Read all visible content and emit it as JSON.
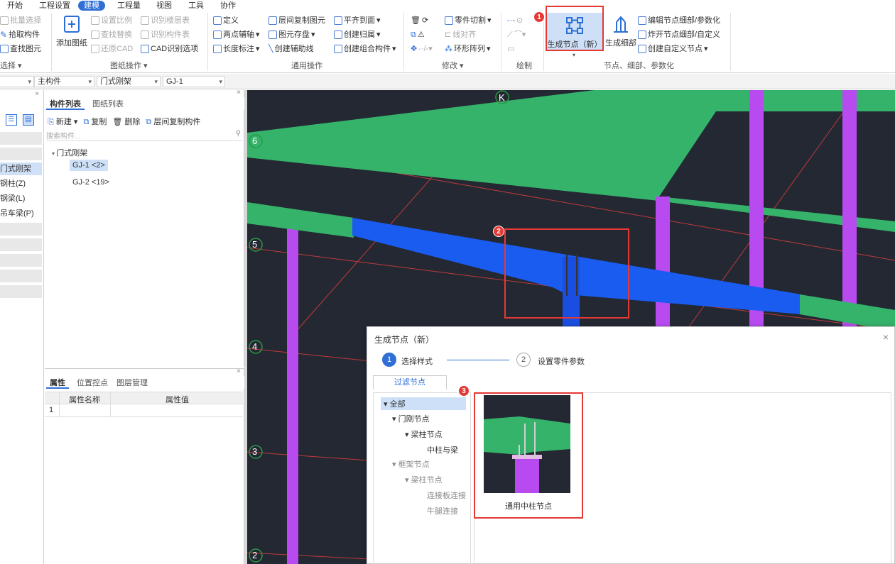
{
  "menu": [
    "开始",
    "工程设置",
    "建模",
    "工程量",
    "视图",
    "工具",
    "协作"
  ],
  "ribbon": {
    "select_group": {
      "items": [
        "批量选择",
        "拾取构件",
        "查找图元"
      ],
      "label": "选择"
    },
    "drawing_ops": {
      "add_drawing": "添加图纸",
      "items": [
        "设置比例",
        "查找替换",
        "还原CAD",
        "识别楼层表",
        "识别构件表",
        "CAD识别选项"
      ],
      "label": "图纸操作"
    },
    "general_ops": {
      "col1": [
        "定义",
        "两点辅轴",
        "长度标注"
      ],
      "col2": [
        "层间复制图元",
        "图元存盘",
        "创建辅助线"
      ],
      "col3": [
        "平齐到面",
        "创建归属",
        "创建组合构件"
      ],
      "label": "通用操作"
    },
    "modify": {
      "items": [
        "零件切割",
        "线对齐",
        "环形阵列"
      ],
      "label": "修改"
    },
    "draw": {
      "label": "绘制"
    },
    "nodes": {
      "gen_node": "生成节点（新）",
      "gen_detail": "生成细部",
      "items": [
        "编辑节点细部/参数化",
        "炸开节点细部/自定义",
        "创建自定义节点"
      ],
      "label": "节点、细部、参数化"
    }
  },
  "selbar": {
    "s2": "主构件",
    "s3": "门式刚架",
    "s4": "GJ-1"
  },
  "left_narrow": {
    "rows": [
      "门式刚架",
      "钢柱(Z)",
      "钢梁(L)",
      "吊车梁(P)"
    ]
  },
  "comp_panel": {
    "tabs": [
      "构件列表",
      "图纸列表"
    ],
    "toolbar": [
      "新建",
      "复制",
      "删除",
      "层间复制构件"
    ],
    "search_placeholder": "搜索构件...",
    "tree_root": "门式刚架",
    "items": [
      "GJ-1 <2>",
      "GJ-2 <19>"
    ]
  },
  "props_panel": {
    "tabs": [
      "属性",
      "位置控点",
      "图层管理"
    ],
    "col_name": "属性名称",
    "col_value": "属性值",
    "row1_index": "1"
  },
  "viewport": {
    "axis_labels": [
      "K",
      "6",
      "5",
      "4",
      "3",
      "2"
    ]
  },
  "dialog": {
    "title": "生成节点（新）",
    "step1_num": "1",
    "step1": "选择样式",
    "step2_num": "2",
    "step2": "设置零件参数",
    "filter_tab": "过滤节点",
    "tree": {
      "all": "全部",
      "portal": "门刚节点",
      "beam_col": "梁柱节点",
      "mid_col": "中柱与梁",
      "frame": "框架节点",
      "beam_col2": "梁柱节点",
      "plate": "连接板连接",
      "corbel": "牛腿连接"
    },
    "card_label": "通用中柱节点"
  },
  "annotations": [
    "1",
    "2",
    "3"
  ],
  "colors": {
    "accent": "#2f6fd6",
    "beam_green": "#36b36b",
    "beam_blue": "#1a5cf0",
    "column_purple": "#b74bf0",
    "highlight_red": "#e53935",
    "viewport_bg": "#232833"
  }
}
